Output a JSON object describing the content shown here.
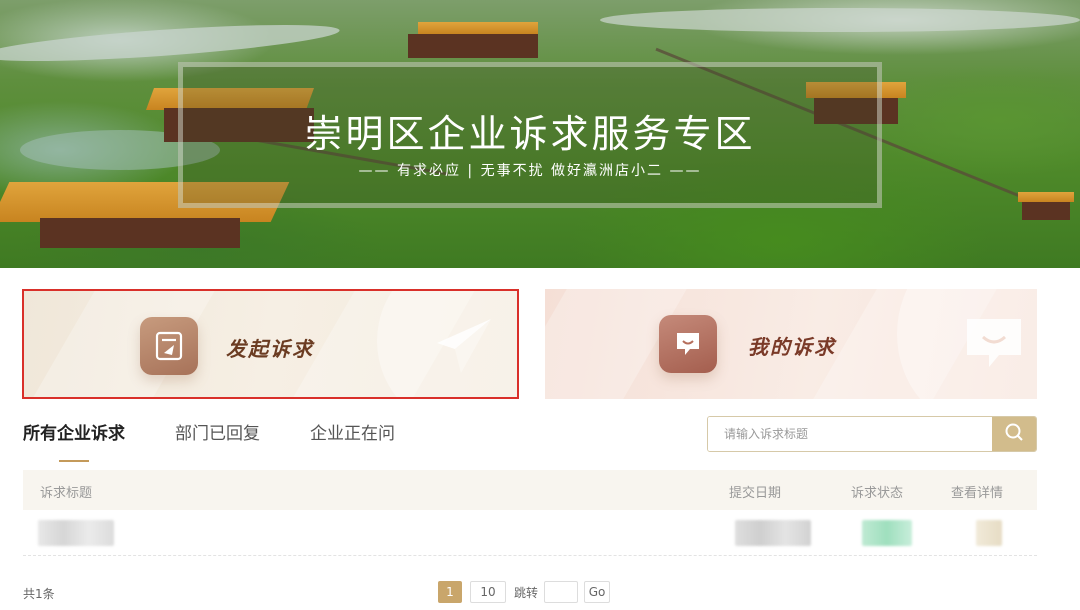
{
  "banner": {
    "title": "崇明区企业诉求服务专区",
    "subtitle": "—— 有求必应 | 无事不扰  做好瀛洲店小二 ——"
  },
  "cards": {
    "raise": {
      "label": "发起诉求",
      "icon": "document-send-icon",
      "bg_icon": "paper-plane-icon"
    },
    "mine": {
      "label": "我的诉求",
      "icon": "chat-bubble-icon",
      "bg_icon": "chat-bubble-icon"
    }
  },
  "tabs": [
    {
      "label": "所有企业诉求",
      "active": true
    },
    {
      "label": "部门已回复",
      "active": false
    },
    {
      "label": "企业正在问",
      "active": false
    }
  ],
  "search": {
    "placeholder": "请输入诉求标题",
    "value": "",
    "icon": "search-icon"
  },
  "table": {
    "headers": {
      "title": "诉求标题",
      "date": "提交日期",
      "status": "诉求状态",
      "detail": "查看详情"
    }
  },
  "footer": {
    "total": "共1条",
    "pages": [
      "1",
      "10"
    ],
    "current_page": "1",
    "jump_label": "跳转",
    "jump_value": "",
    "go_label": "Go"
  },
  "colors": {
    "accent": "#c9a66b",
    "highlight_border": "#d9302a",
    "status_blur": "#8fd6b0"
  }
}
